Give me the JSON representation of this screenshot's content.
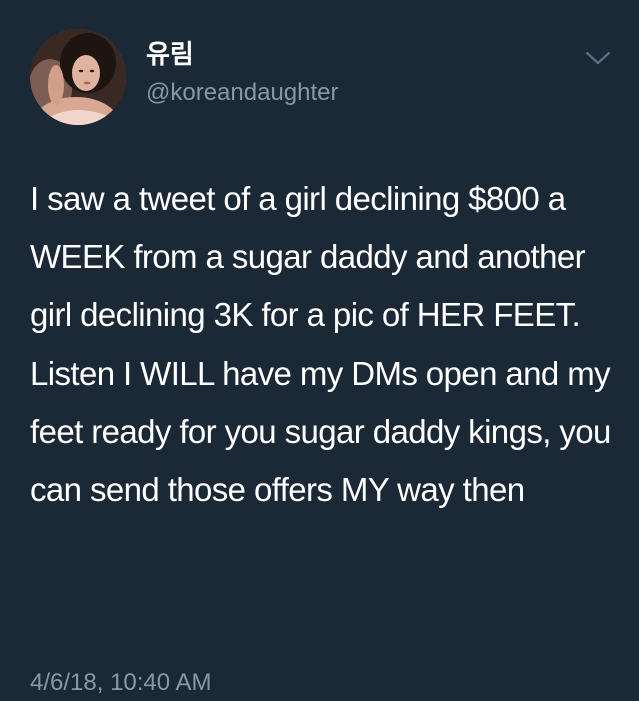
{
  "tweet": {
    "display_name": "유림",
    "handle": "@koreandaughter",
    "text": "I saw a tweet of a girl declining $800 a WEEK from a sugar daddy and another girl declining 3K for a pic of HER FEET. Listen I WILL have my DMs open and my feet ready for you sugar daddy kings, you can send those offers MY way then",
    "timestamp": "4/6/18, 10:40 AM"
  },
  "icons": {
    "avatar": "profile-photo",
    "menu": "chevron-down-icon"
  },
  "colors": {
    "background": "#1b2836",
    "primary_text": "#ffffff",
    "secondary_text": "#8899a6"
  }
}
